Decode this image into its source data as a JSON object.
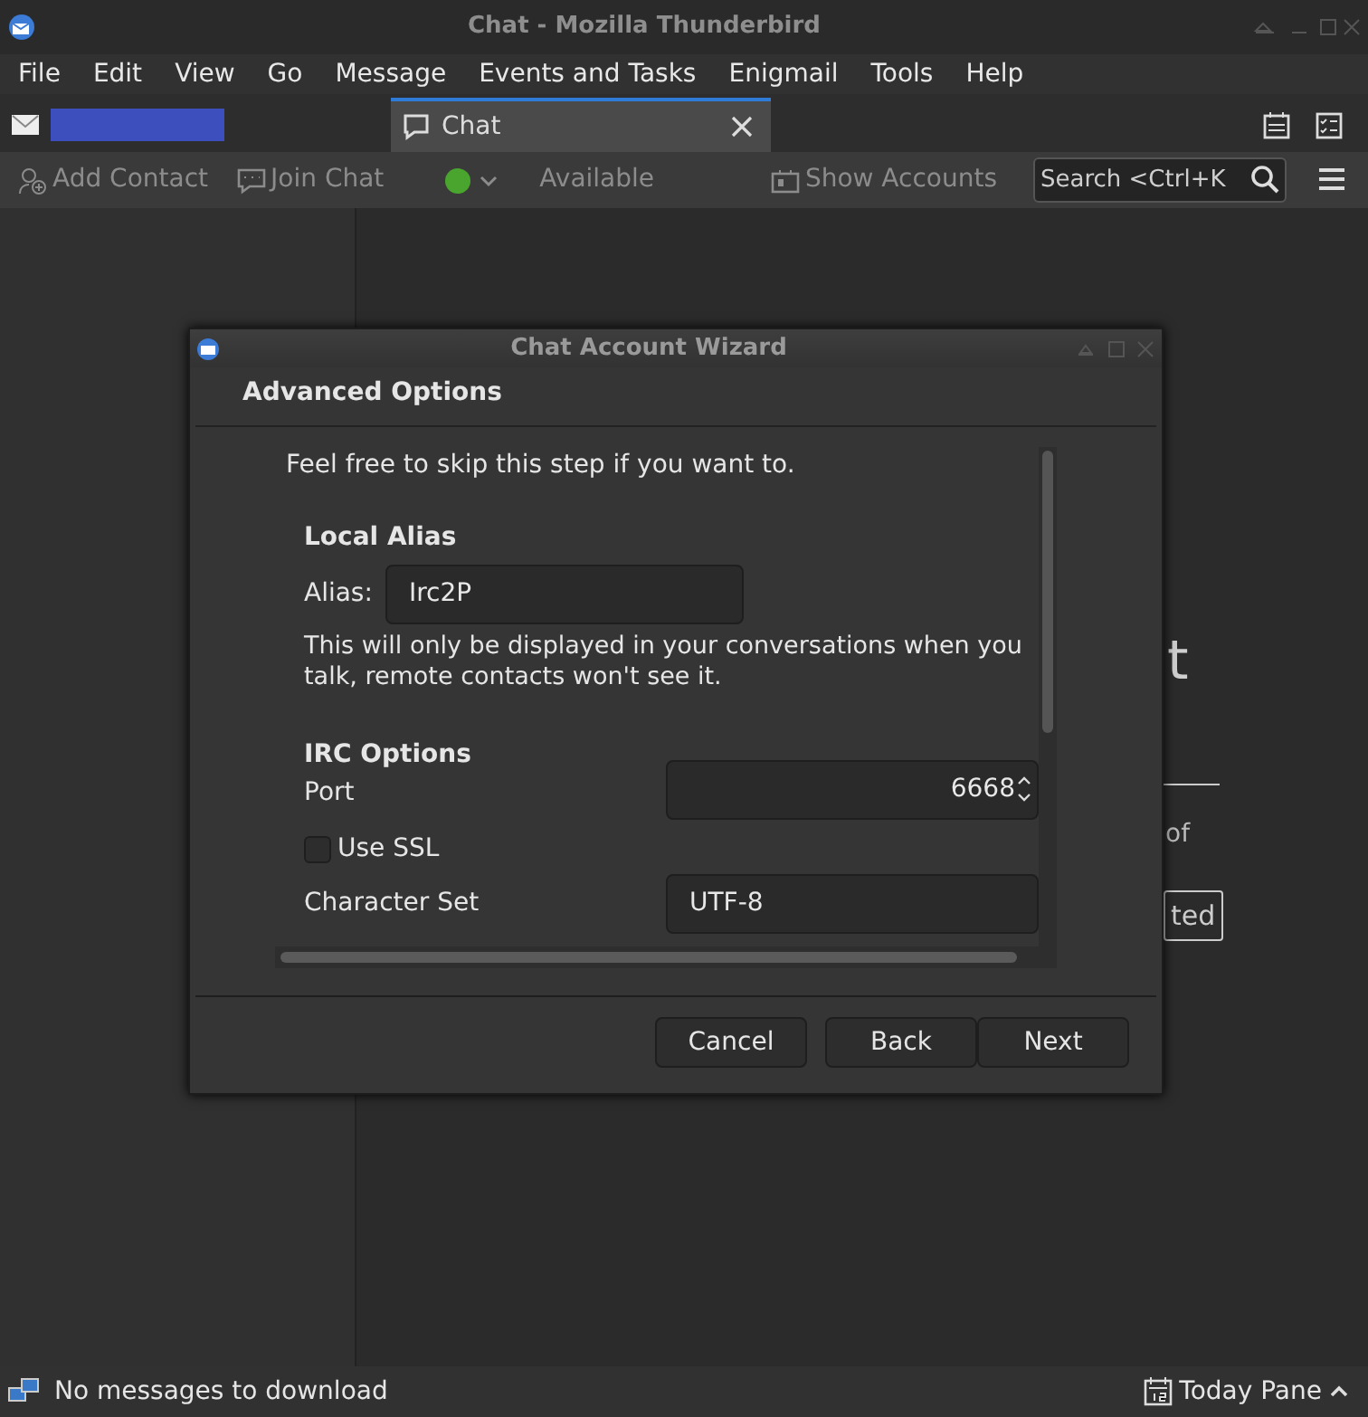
{
  "window": {
    "title": "Chat - Mozilla Thunderbird"
  },
  "menu": [
    "File",
    "Edit",
    "View",
    "Go",
    "Message",
    "Events and Tasks",
    "Enigmail",
    "Tools",
    "Help"
  ],
  "tabs": [
    {
      "kind": "mail",
      "selected": false
    },
    {
      "kind": "chat",
      "label": "Chat",
      "selected": true
    }
  ],
  "toolbar": {
    "add_contact": "Add Contact",
    "join_chat": "Join Chat",
    "status": "Available",
    "show_accounts": "Show Accounts",
    "search": {
      "placeholder": "Search <Ctrl+K"
    }
  },
  "background": {
    "heading": "t",
    "text": "of",
    "button": "ted"
  },
  "dialog": {
    "title": "Chat Account Wizard",
    "heading": "Advanced Options",
    "intro": "Feel free to skip this step if you want to.",
    "alias_section": "Local Alias",
    "alias_label": "Alias:",
    "alias_value": "Irc2P",
    "alias_note": "This will only be displayed in your conversations when you talk, remote contacts won't see it.",
    "irc_section": "IRC Options",
    "port_label": "Port",
    "port_value": "6668",
    "ssl": {
      "label": "Use SSL",
      "checked": false
    },
    "charset_label": "Character Set",
    "charset_value": "UTF-8",
    "buttons": [
      "Cancel",
      "Back",
      "Next"
    ]
  },
  "status_bar": {
    "message": "No messages to download",
    "today_pane": "Today Pane"
  }
}
